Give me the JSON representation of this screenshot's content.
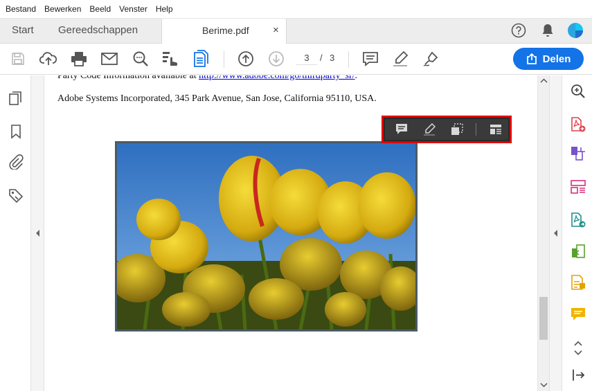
{
  "menubar": {
    "items": [
      "Bestand",
      "Bewerken",
      "Beeld",
      "Venster",
      "Help"
    ]
  },
  "tabs": {
    "start": "Start",
    "tools": "Gereedschappen",
    "document": "Berime.pdf",
    "close": "×"
  },
  "toolbar": {
    "current_page": "3",
    "page_separator": "/",
    "total_pages": "3",
    "share_label": "Delen"
  },
  "document": {
    "line1_prefix": "Party Code Information available at ",
    "line1_link": "http://www.adobe.com/go/thirdparty_sr/",
    "line1_suffix": ".",
    "line2": "Adobe Systems Incorporated, 345 Park Avenue, San Jose, California 95110, USA."
  },
  "floating_toolbar": {
    "icons": [
      "comment-icon",
      "highlight-icon",
      "crop-icon",
      "layout-icon"
    ]
  },
  "colors": {
    "accent": "#1473e6",
    "highlight_border": "#e00000",
    "sky": "#3a7cc6",
    "tulip": "#e8c21a"
  }
}
